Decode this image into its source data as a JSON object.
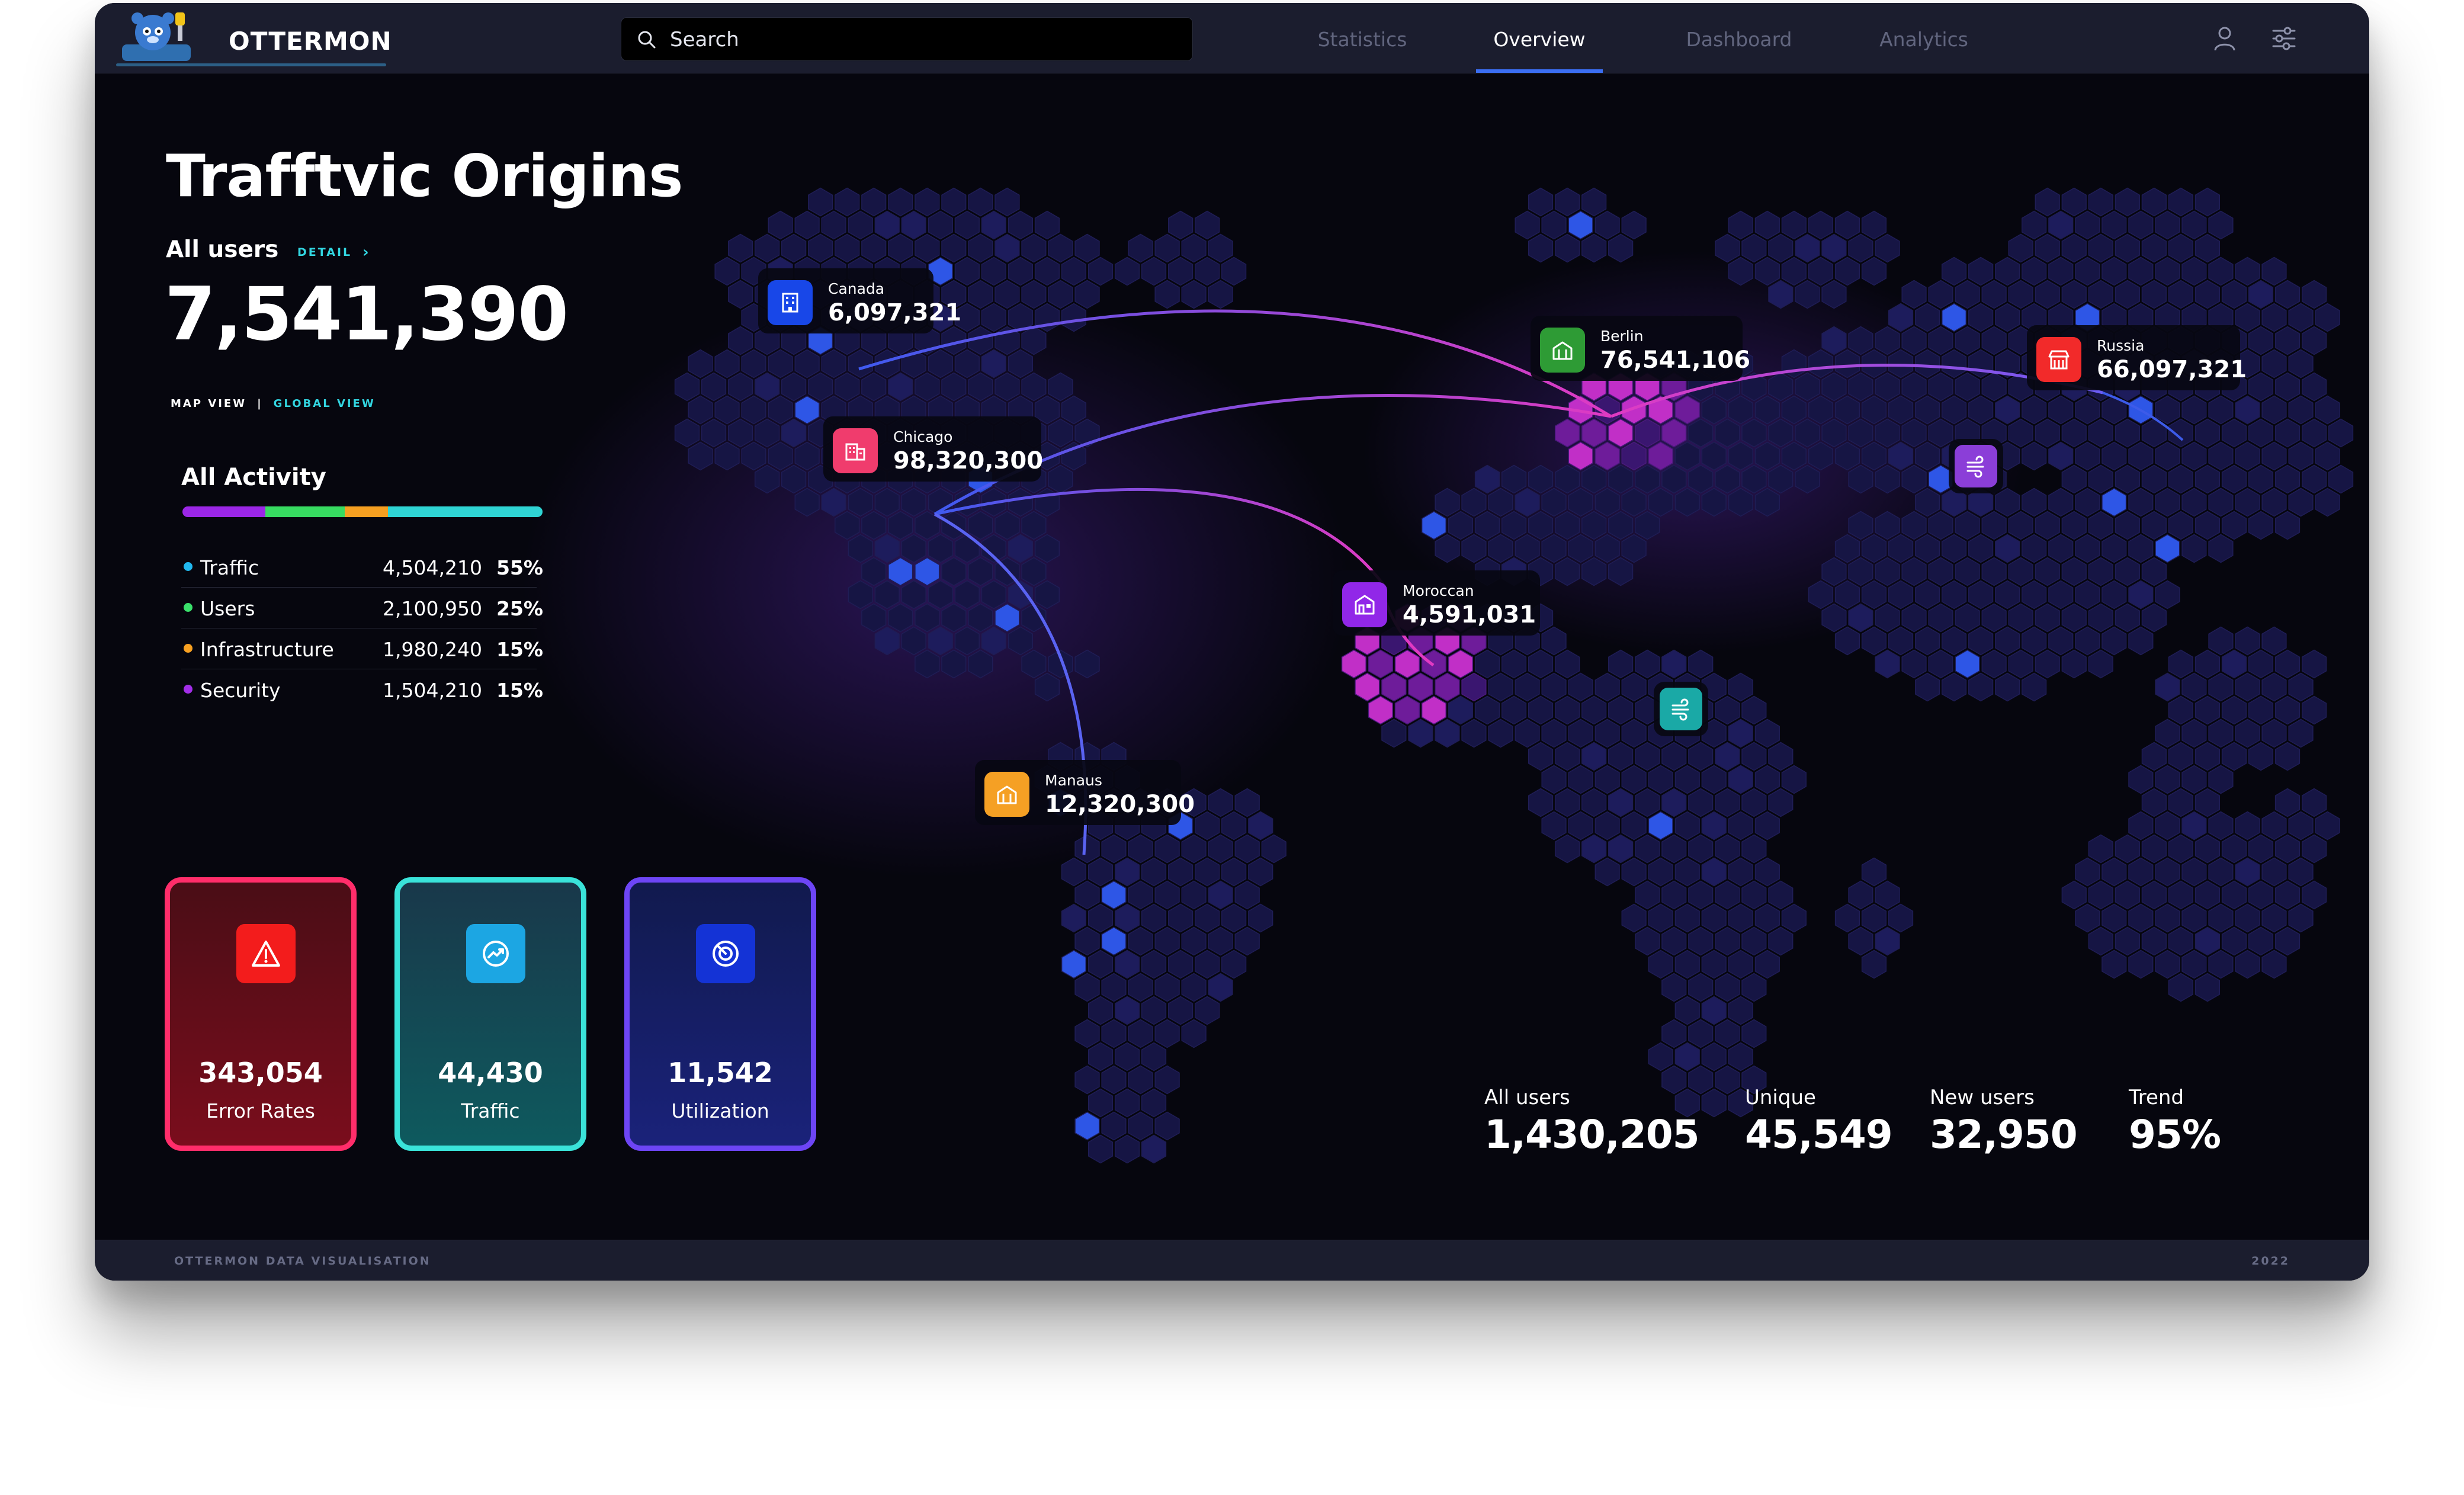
{
  "app": {
    "name": "OTTERMON"
  },
  "search": {
    "placeholder": "Search"
  },
  "nav": {
    "tabs": [
      {
        "label": "Statistics",
        "active": false
      },
      {
        "label": "Overview",
        "active": true
      },
      {
        "label": "Dashboard",
        "active": false
      },
      {
        "label": "Analytics",
        "active": false
      }
    ],
    "icons": [
      "user-icon",
      "sliders-icon"
    ]
  },
  "hero": {
    "title": "Trafftvic Origins",
    "all_users_label": "All users",
    "detail_label": "DETAIL",
    "total_users": "7,541,390",
    "view_map": "MAP VIEW",
    "view_separator": "|",
    "view_global": "GLOBAL VIEW"
  },
  "activity": {
    "title": "All Activity",
    "items": [
      {
        "label": "Traffic",
        "value": "4,504,210",
        "percent": "55%",
        "color": "#21b8ef"
      },
      {
        "label": "Users",
        "value": "2,100,950",
        "percent": "25%",
        "color": "#3ae06b"
      },
      {
        "label": "Infrastructure",
        "value": "1,980,240",
        "percent": "15%",
        "color": "#f7a021"
      },
      {
        "label": "Security",
        "value": "1,504,210",
        "percent": "15%",
        "color": "#a22ee8"
      }
    ],
    "bar_segments": [
      {
        "share": 0.23,
        "color": "#9b26e6"
      },
      {
        "share": 0.22,
        "color": "#37db61"
      },
      {
        "share": 0.12,
        "color": "#f59f21"
      },
      {
        "share": 0.43,
        "color": "#2fd4d4"
      }
    ]
  },
  "kpis": [
    {
      "value": "343,054",
      "label": "Error Rates",
      "icon": "warning-icon",
      "accent": "#ff2d6a",
      "icon_bg": "#f31c1c"
    },
    {
      "value": "44,430",
      "label": "Traffic",
      "icon": "trend-icon",
      "accent": "#3ae3d9",
      "icon_bg": "#1ca6e3"
    },
    {
      "value": "11,542",
      "label": "Utilization",
      "icon": "gauge-icon",
      "accent": "#6d45f5",
      "icon_bg": "#1433d6"
    }
  ],
  "locations": [
    {
      "name": "Canada",
      "value": "6,097,321",
      "icon": "building-icon",
      "color": "#1847e8"
    },
    {
      "name": "Chicago",
      "value": "98,320,300",
      "icon": "office-icon",
      "color": "#f03c6d"
    },
    {
      "name": "Berlin",
      "value": "76,541,106",
      "icon": "landmark-icon",
      "color": "#2e9b35"
    },
    {
      "name": "Russia",
      "value": "66,097,321",
      "icon": "store-icon",
      "color": "#f22a2a"
    },
    {
      "name": "Moroccan",
      "value": "4,591,031",
      "icon": "house-icon",
      "color": "#9127e8"
    },
    {
      "name": "Manaus",
      "value": "12,320,300",
      "icon": "landmark-icon",
      "color": "#f5a024"
    }
  ],
  "map_markers": [
    {
      "icon": "wind-icon",
      "color": "#8b3ed8"
    },
    {
      "icon": "wind-icon",
      "color": "#1aa9a6"
    }
  ],
  "stats": [
    {
      "label": "All users",
      "value": "1,430,205"
    },
    {
      "label": "Unique",
      "value": "45,549"
    },
    {
      "label": "New users",
      "value": "32,950"
    },
    {
      "label": "Trend",
      "value": "95%"
    }
  ],
  "footer": {
    "left": "OTTERMON DATA VISUALISATION",
    "right": "2022"
  }
}
